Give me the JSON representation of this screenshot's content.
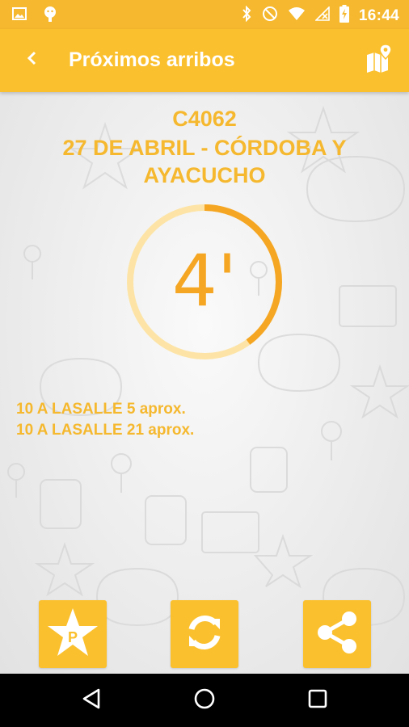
{
  "status_bar": {
    "time": "16:44",
    "icons": [
      "image-icon",
      "android-icon",
      "bluetooth-icon",
      "do-not-disturb-icon",
      "wifi-icon",
      "no-signal-icon",
      "battery-charging-icon"
    ]
  },
  "app_bar": {
    "title": "Próximos arribos",
    "back_icon": "chevron-left-icon",
    "map_icon": "map-pin-icon"
  },
  "stop": {
    "code": "C4062",
    "name": "27 DE ABRIL - CÓRDOBA Y AYACUCHO"
  },
  "timer": {
    "value": "4'",
    "progress_fraction": 0.4
  },
  "arrivals": [
    "10 A LASALLE 5 aprox.",
    "10 A LASALLE 21 aprox."
  ],
  "actions": {
    "favorite_icon": "star-parking-icon",
    "refresh_icon": "refresh-icon",
    "share_icon": "share-icon"
  },
  "colors": {
    "primary": "#fbc02d",
    "status_bar": "#f5b82e",
    "accent_text": "#f5b82e",
    "timer_text": "#f5a623",
    "timer_track": "#fde4a6"
  }
}
